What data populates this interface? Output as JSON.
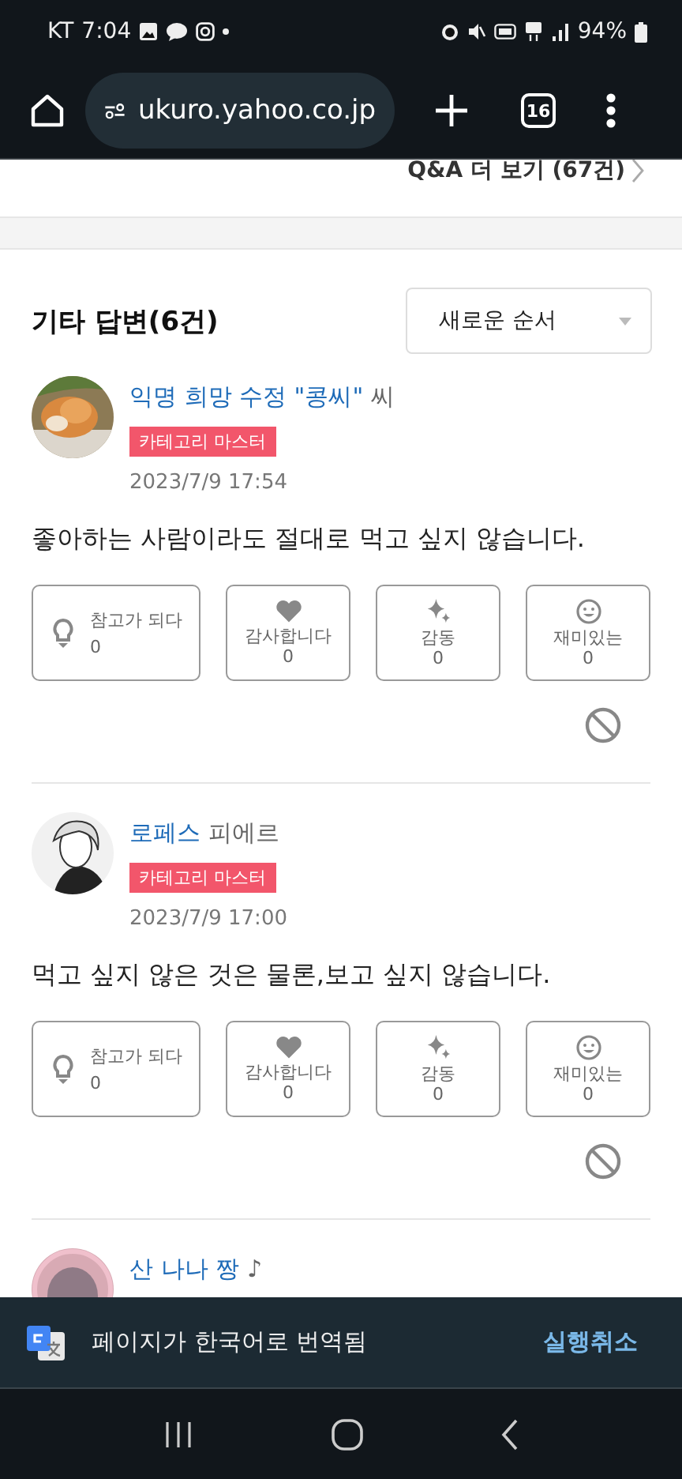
{
  "status_bar": {
    "carrier": "KT",
    "time": "7:04",
    "battery": "94%"
  },
  "browser": {
    "url": "ukuro.yahoo.co.jp",
    "tab_count": "16"
  },
  "more_link": "Q&A 더 보기 (67건)",
  "answers_header": {
    "title": "기타 답변(6건)",
    "sort": "새로운 순서"
  },
  "answers": [
    {
      "name": "익명 희망 수정 \"콩씨\"",
      "suffix": "씨",
      "badge": "카테고리 마스터",
      "date": "2023/7/9 17:54",
      "text": "좋아하는 사람이라도 절대로 먹고 싶지 않습니다.",
      "reactions": [
        {
          "kind": "helpful",
          "label": "참고가 되다",
          "count": "0"
        },
        {
          "kind": "thanks",
          "label": "감사합니다",
          "count": "0"
        },
        {
          "kind": "moved",
          "label": "감동",
          "count": "0"
        },
        {
          "kind": "funny",
          "label": "재미있는",
          "count": "0"
        }
      ]
    },
    {
      "name": "로페스",
      "suffix": "피에르",
      "badge": "카테고리 마스터",
      "date": "2023/7/9 17:00",
      "text": "먹고 싶지 않은 것은 물론,보고 싶지 않습니다.",
      "reactions": [
        {
          "kind": "helpful",
          "label": "참고가 되다",
          "count": "0"
        },
        {
          "kind": "thanks",
          "label": "감사합니다",
          "count": "0"
        },
        {
          "kind": "moved",
          "label": "감동",
          "count": "0"
        },
        {
          "kind": "funny",
          "label": "재미있는",
          "count": "0"
        }
      ]
    }
  ],
  "next_answer": {
    "name": "산 나나 짱",
    "suffix": "♪"
  },
  "translate_bar": {
    "message": "페이지가 한국어로 번역됨",
    "action": "실행취소"
  }
}
